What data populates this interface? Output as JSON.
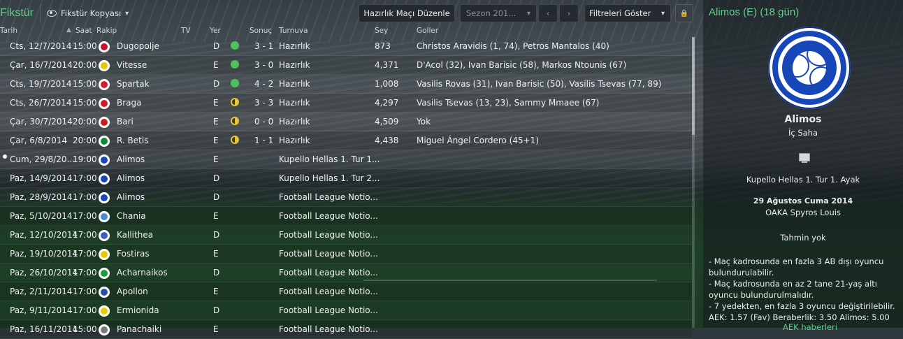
{
  "header": {
    "title": "Fikstür",
    "view_label": "Fikstür Kopyası",
    "friendly_button": "Hazırlık Maçı Düzenle",
    "season_placeholder": "Sezon 201...",
    "filters_button": "Filtreleri Göster"
  },
  "columns": {
    "date": "Tarih",
    "time": "Saat",
    "opponent": "Rakip",
    "tv": "TV",
    "venue": "Yer",
    "result": "Sonuç",
    "competition": "Turnuva",
    "attendance": "Sey",
    "goals": "Goller"
  },
  "fixtures": [
    {
      "date": "Cts, 12/7/2014",
      "time": "15:00",
      "opponent": "Dugopolje",
      "crest": "#c8102e",
      "venue": "D",
      "outcome": "win",
      "result": "3 - 1",
      "competition": "Hazırlık",
      "attendance": "873",
      "goals": "Christos Aravidis (1, 74), Petros Mantalos (40)"
    },
    {
      "date": "Çar, 16/7/2014",
      "time": "20:00",
      "opponent": "Vitesse",
      "crest": "#e5c700",
      "venue": "E",
      "outcome": "win",
      "result": "3 - 0",
      "competition": "Hazırlık",
      "attendance": "4,371",
      "goals": "D'Acol (32), Ivan Barisic (58), Markos Ntounis (67)"
    },
    {
      "date": "Cts, 19/7/2014",
      "time": "15:00",
      "opponent": "Spartak",
      "crest": "#d0202e",
      "venue": "D",
      "outcome": "win",
      "result": "4 - 2",
      "competition": "Hazırlık",
      "attendance": "1,008",
      "goals": "Vasilis Rovas (31), Ivan Barisic (50), Vasilis Tsevas (77, 89)"
    },
    {
      "date": "Cts, 26/7/2014",
      "time": "15:00",
      "opponent": "Braga",
      "crest": "#d31b27",
      "venue": "E",
      "outcome": "draw",
      "result": "3 - 3",
      "competition": "Hazırlık",
      "attendance": "4,297",
      "goals": "Vasilis Tsevas (13, 23), Sammy Mmaee (67)"
    },
    {
      "date": "Çar, 30/7/2014",
      "time": "20:00",
      "opponent": "Bari",
      "crest": "#c8202a",
      "venue": "E",
      "outcome": "draw",
      "result": "0 - 0",
      "competition": "Hazırlık",
      "attendance": "4,509",
      "goals": "Yok"
    },
    {
      "date": "Çar, 6/8/2014",
      "time": "20:00",
      "opponent": "R. Betis",
      "crest": "#0b8a3c",
      "venue": "E",
      "outcome": "draw",
      "result": "1 - 1",
      "competition": "Hazırlık",
      "attendance": "4,438",
      "goals": "Miguel Ángel Cordero (45+1)"
    },
    {
      "date": "Cum, 29/8/20...",
      "time": "19:00",
      "opponent": "Alimos",
      "crest": "#1646b8",
      "venue": "E",
      "outcome": "",
      "result": "",
      "competition": "Kupello Hellas 1. Tur 1...",
      "attendance": "",
      "goals": "",
      "current": true
    },
    {
      "date": "Paz, 14/9/2014",
      "time": "17:00",
      "opponent": "Alimos",
      "crest": "#1646b8",
      "venue": "D",
      "outcome": "",
      "result": "",
      "competition": "Kupello Hellas 1. Tur 2...",
      "attendance": "",
      "goals": ""
    },
    {
      "date": "Paz, 28/9/2014",
      "time": "17:00",
      "opponent": "Alimos",
      "crest": "#1646b8",
      "venue": "D",
      "outcome": "",
      "result": "",
      "competition": "Football League Notio...",
      "attendance": "",
      "goals": ""
    },
    {
      "date": "Paz, 5/10/2014",
      "time": "17:00",
      "opponent": "Chania",
      "crest": "#4a8bd0",
      "venue": "E",
      "outcome": "",
      "result": "",
      "competition": "Football League Notio...",
      "attendance": "",
      "goals": ""
    },
    {
      "date": "Paz, 12/10/2014",
      "time": "17:00",
      "opponent": "Kallithea",
      "crest": "#3a5fc0",
      "venue": "D",
      "outcome": "",
      "result": "",
      "competition": "Football League Notio...",
      "attendance": "",
      "goals": ""
    },
    {
      "date": "Paz, 19/10/2014",
      "time": "17:00",
      "opponent": "Fostiras",
      "crest": "#e8c800",
      "venue": "E",
      "outcome": "",
      "result": "",
      "competition": "Football League Notio...",
      "attendance": "",
      "goals": ""
    },
    {
      "date": "Paz, 26/10/2014",
      "time": "17:00",
      "opponent": "Acharnaikos",
      "crest": "#1e9a3c",
      "venue": "D",
      "outcome": "",
      "result": "",
      "competition": "Football League Notio...",
      "attendance": "",
      "goals": ""
    },
    {
      "date": "Paz, 2/11/2014",
      "time": "17:00",
      "opponent": "Apollon",
      "crest": "#2b4ea8",
      "venue": "E",
      "outcome": "",
      "result": "",
      "competition": "Football League Notio...",
      "attendance": "",
      "goals": ""
    },
    {
      "date": "Paz, 9/11/2014",
      "time": "17:00",
      "opponent": "Ermionida",
      "crest": "#e6cc00",
      "venue": "D",
      "outcome": "",
      "result": "",
      "competition": "Football League Notio...",
      "attendance": "",
      "goals": ""
    },
    {
      "date": "Paz, 16/11/2014",
      "time": "15:00",
      "opponent": "Panachaiki",
      "crest": "#7a7a7a",
      "venue": "E",
      "outcome": "",
      "result": "",
      "competition": "Football League Notio...",
      "attendance": "",
      "goals": ""
    }
  ],
  "panel": {
    "title": "Alimos (E) (18 gün)",
    "team_name": "Alimos",
    "venue_label": "İç Saha",
    "competition": "Kupello Hellas 1. Tur 1. Ayak",
    "date": "29 Ağustos Cuma 2014",
    "stadium": "OAKA Spyros Louis",
    "prediction": "Tahmin yok",
    "notes": [
      "- Maç kadrosunda en fazla 3 AB dışı oyuncu bulundurulabilir.",
      "- Maç kadrosunda en az 2 tane 21-yaş altı oyuncu bulundurulmalıdır.",
      "- 7 yedekten, en fazla 3 oyuncu değiştirilebilir."
    ],
    "odds": "AEK: 1.57 (Fav) Beraberlik: 3.50 Alimos: 5.00",
    "news_link": "AEK haberleri"
  }
}
